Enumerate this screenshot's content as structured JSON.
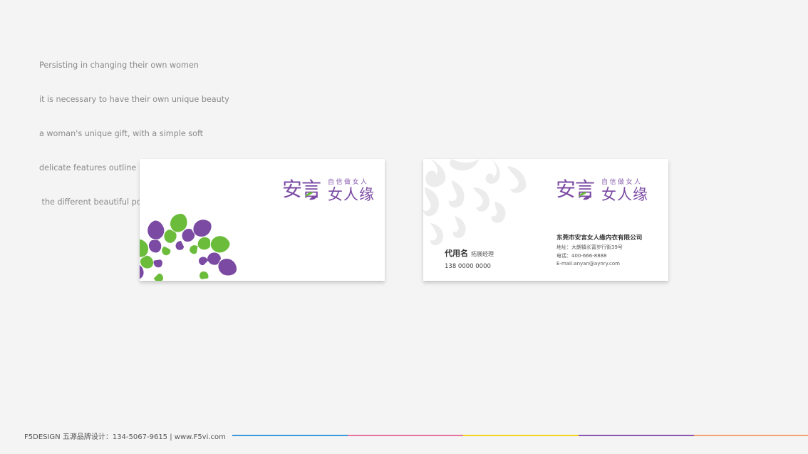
{
  "intro": {
    "lines": [
      "Persisting in changing their own women",
      "it is necessary to have their own unique beauty",
      "a woman's unique gift, with a simple soft",
      "delicate features outline",
      " the different beautiful posture"
    ]
  },
  "brand": {
    "logo_main": "安言",
    "logo_sub": "女人缘",
    "tagline": "自信做女人",
    "purple": "#7b4aa3",
    "green": "#6cbc3c"
  },
  "card_back": {
    "person_name": "代用名",
    "person_title": "拓展经理",
    "phone": "138 0000 0000",
    "company_name": "东莞市安言女人缘内衣有限公司",
    "address": "地址：大朗镇长富步行街39号",
    "tel": "电话：400-666-8888",
    "email": "E-mail:anyan@aynry.com"
  },
  "footer": {
    "text": "F5DESIGN 五源品牌设计：134-5067-9615 | www.F5vi.com",
    "rule_colors": [
      "#3a9ad9",
      "#e6739f",
      "#f3d21b",
      "#8a56b0",
      "#f2a36b"
    ]
  }
}
